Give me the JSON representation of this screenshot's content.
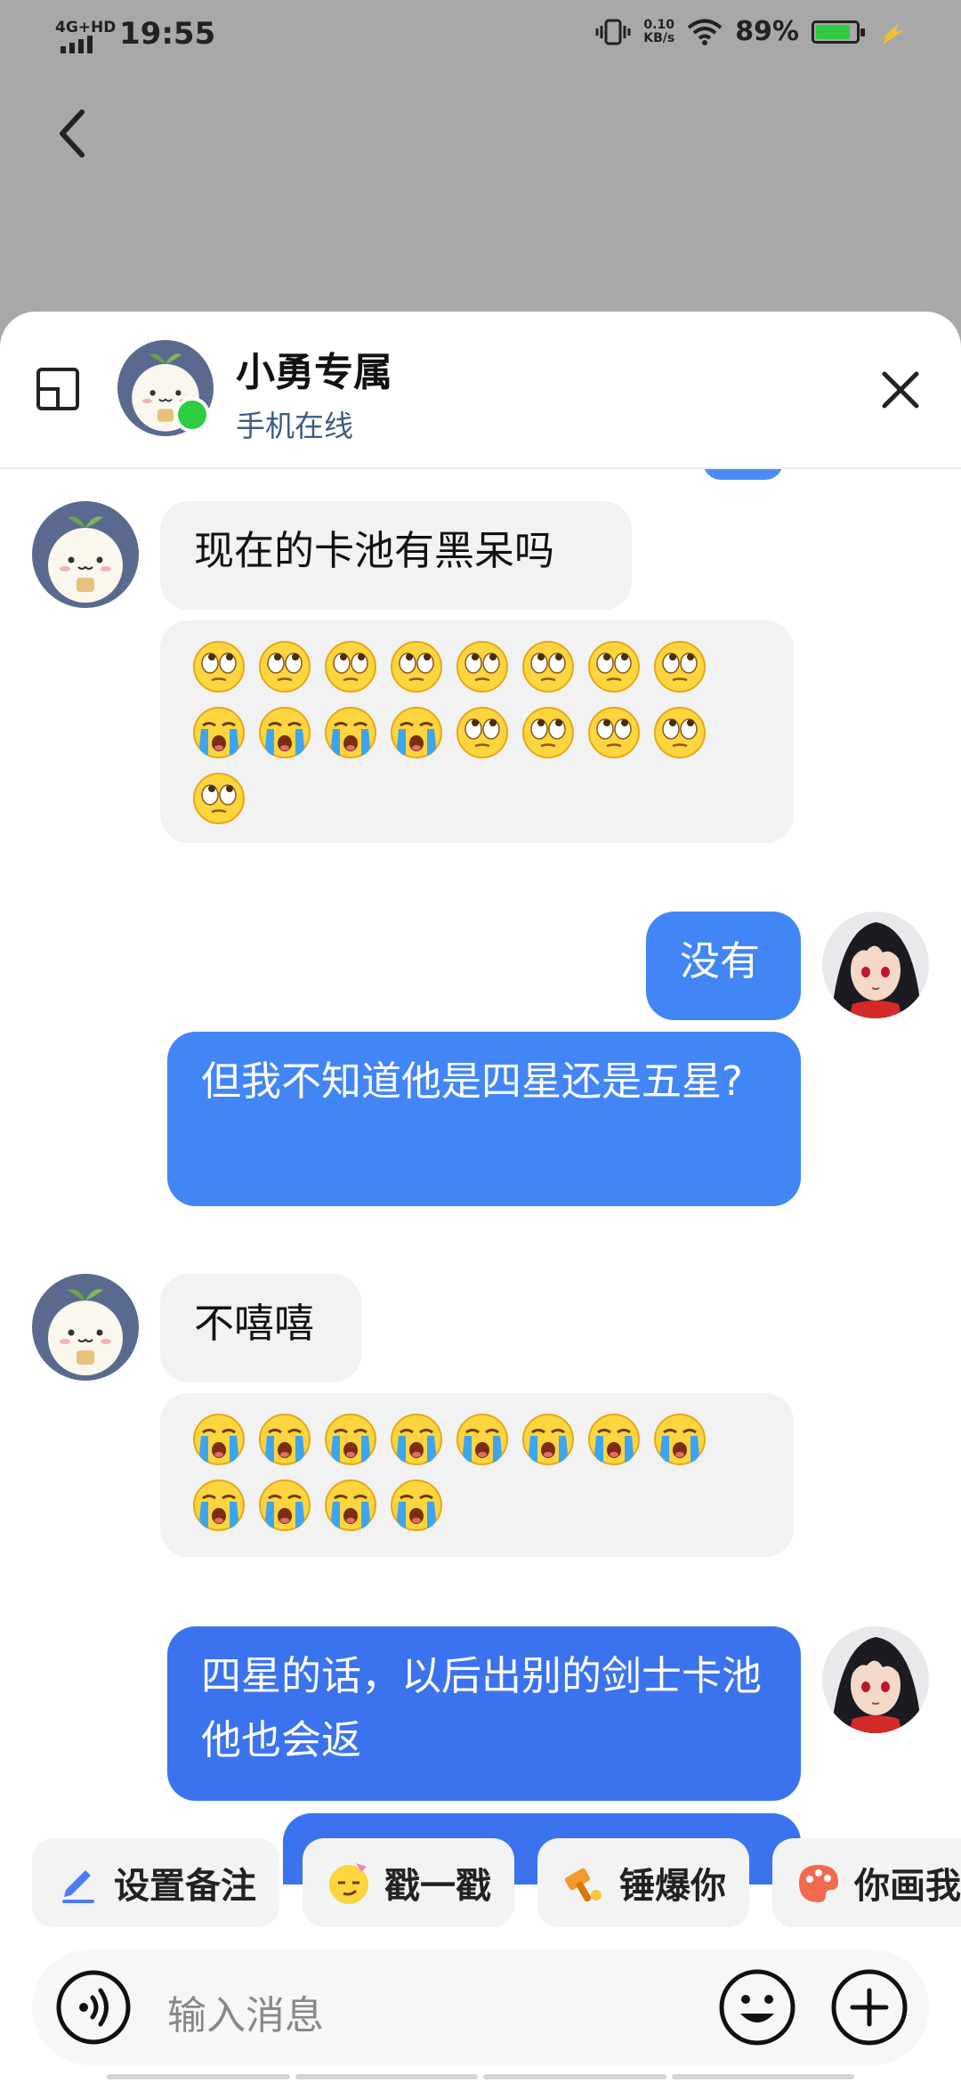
{
  "status_bar": {
    "network": "4G+HD",
    "time": "19:55",
    "speed_value": "0.10",
    "speed_unit": "KB/s",
    "battery": "89%"
  },
  "header": {
    "contact_name": "小勇专属",
    "contact_status": "手机在线"
  },
  "messages": [
    {
      "side": "in",
      "text": "现在的卡池有黑呆吗"
    },
    {
      "side": "in",
      "emojis": [
        "rolling-eyes-face",
        "rolling-eyes-face",
        "rolling-eyes-face",
        "rolling-eyes-face",
        "rolling-eyes-face",
        "rolling-eyes-face",
        "rolling-eyes-face",
        "rolling-eyes-face",
        "loudly-crying-face",
        "loudly-crying-face",
        "loudly-crying-face",
        "loudly-crying-face",
        "rolling-eyes-face",
        "rolling-eyes-face",
        "rolling-eyes-face",
        "rolling-eyes-face",
        "rolling-eyes-face"
      ]
    },
    {
      "side": "out",
      "text": "没有"
    },
    {
      "side": "out",
      "text": "但我不知道他是四星还是五星?"
    },
    {
      "side": "in",
      "text": "不嘻嘻"
    },
    {
      "side": "in",
      "emojis": [
        "loudly-crying-face",
        "loudly-crying-face",
        "loudly-crying-face",
        "loudly-crying-face",
        "loudly-crying-face",
        "loudly-crying-face",
        "loudly-crying-face",
        "loudly-crying-face",
        "loudly-crying-face",
        "loudly-crying-face",
        "loudly-crying-face",
        "loudly-crying-face"
      ]
    },
    {
      "side": "out",
      "text": "四星的话，以后出别的剑士卡池他也会返"
    }
  ],
  "quick_actions": [
    "设置备注",
    "戳一戳",
    "锤爆你",
    "你画我"
  ],
  "input": {
    "placeholder": "输入消息"
  },
  "colors": {
    "outgoing_bubble": "#4286f5",
    "incoming_bubble": "#f2f2f2",
    "online": "#2ecc40",
    "status_text": "#3f5b86"
  }
}
